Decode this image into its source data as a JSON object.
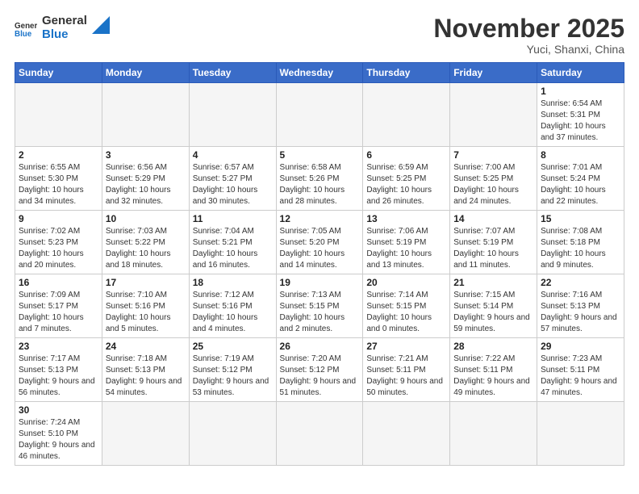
{
  "logo": {
    "text_general": "General",
    "text_blue": "Blue"
  },
  "header": {
    "month": "November 2025",
    "location": "Yuci, Shanxi, China"
  },
  "weekdays": [
    "Sunday",
    "Monday",
    "Tuesday",
    "Wednesday",
    "Thursday",
    "Friday",
    "Saturday"
  ],
  "weeks": [
    [
      {
        "day": "",
        "info": ""
      },
      {
        "day": "",
        "info": ""
      },
      {
        "day": "",
        "info": ""
      },
      {
        "day": "",
        "info": ""
      },
      {
        "day": "",
        "info": ""
      },
      {
        "day": "",
        "info": ""
      },
      {
        "day": "1",
        "info": "Sunrise: 6:54 AM\nSunset: 5:31 PM\nDaylight: 10 hours and 37 minutes."
      }
    ],
    [
      {
        "day": "2",
        "info": "Sunrise: 6:55 AM\nSunset: 5:30 PM\nDaylight: 10 hours and 34 minutes."
      },
      {
        "day": "3",
        "info": "Sunrise: 6:56 AM\nSunset: 5:29 PM\nDaylight: 10 hours and 32 minutes."
      },
      {
        "day": "4",
        "info": "Sunrise: 6:57 AM\nSunset: 5:27 PM\nDaylight: 10 hours and 30 minutes."
      },
      {
        "day": "5",
        "info": "Sunrise: 6:58 AM\nSunset: 5:26 PM\nDaylight: 10 hours and 28 minutes."
      },
      {
        "day": "6",
        "info": "Sunrise: 6:59 AM\nSunset: 5:25 PM\nDaylight: 10 hours and 26 minutes."
      },
      {
        "day": "7",
        "info": "Sunrise: 7:00 AM\nSunset: 5:25 PM\nDaylight: 10 hours and 24 minutes."
      },
      {
        "day": "8",
        "info": "Sunrise: 7:01 AM\nSunset: 5:24 PM\nDaylight: 10 hours and 22 minutes."
      }
    ],
    [
      {
        "day": "9",
        "info": "Sunrise: 7:02 AM\nSunset: 5:23 PM\nDaylight: 10 hours and 20 minutes."
      },
      {
        "day": "10",
        "info": "Sunrise: 7:03 AM\nSunset: 5:22 PM\nDaylight: 10 hours and 18 minutes."
      },
      {
        "day": "11",
        "info": "Sunrise: 7:04 AM\nSunset: 5:21 PM\nDaylight: 10 hours and 16 minutes."
      },
      {
        "day": "12",
        "info": "Sunrise: 7:05 AM\nSunset: 5:20 PM\nDaylight: 10 hours and 14 minutes."
      },
      {
        "day": "13",
        "info": "Sunrise: 7:06 AM\nSunset: 5:19 PM\nDaylight: 10 hours and 13 minutes."
      },
      {
        "day": "14",
        "info": "Sunrise: 7:07 AM\nSunset: 5:19 PM\nDaylight: 10 hours and 11 minutes."
      },
      {
        "day": "15",
        "info": "Sunrise: 7:08 AM\nSunset: 5:18 PM\nDaylight: 10 hours and 9 minutes."
      }
    ],
    [
      {
        "day": "16",
        "info": "Sunrise: 7:09 AM\nSunset: 5:17 PM\nDaylight: 10 hours and 7 minutes."
      },
      {
        "day": "17",
        "info": "Sunrise: 7:10 AM\nSunset: 5:16 PM\nDaylight: 10 hours and 5 minutes."
      },
      {
        "day": "18",
        "info": "Sunrise: 7:12 AM\nSunset: 5:16 PM\nDaylight: 10 hours and 4 minutes."
      },
      {
        "day": "19",
        "info": "Sunrise: 7:13 AM\nSunset: 5:15 PM\nDaylight: 10 hours and 2 minutes."
      },
      {
        "day": "20",
        "info": "Sunrise: 7:14 AM\nSunset: 5:15 PM\nDaylight: 10 hours and 0 minutes."
      },
      {
        "day": "21",
        "info": "Sunrise: 7:15 AM\nSunset: 5:14 PM\nDaylight: 9 hours and 59 minutes."
      },
      {
        "day": "22",
        "info": "Sunrise: 7:16 AM\nSunset: 5:13 PM\nDaylight: 9 hours and 57 minutes."
      }
    ],
    [
      {
        "day": "23",
        "info": "Sunrise: 7:17 AM\nSunset: 5:13 PM\nDaylight: 9 hours and 56 minutes."
      },
      {
        "day": "24",
        "info": "Sunrise: 7:18 AM\nSunset: 5:13 PM\nDaylight: 9 hours and 54 minutes."
      },
      {
        "day": "25",
        "info": "Sunrise: 7:19 AM\nSunset: 5:12 PM\nDaylight: 9 hours and 53 minutes."
      },
      {
        "day": "26",
        "info": "Sunrise: 7:20 AM\nSunset: 5:12 PM\nDaylight: 9 hours and 51 minutes."
      },
      {
        "day": "27",
        "info": "Sunrise: 7:21 AM\nSunset: 5:11 PM\nDaylight: 9 hours and 50 minutes."
      },
      {
        "day": "28",
        "info": "Sunrise: 7:22 AM\nSunset: 5:11 PM\nDaylight: 9 hours and 49 minutes."
      },
      {
        "day": "29",
        "info": "Sunrise: 7:23 AM\nSunset: 5:11 PM\nDaylight: 9 hours and 47 minutes."
      }
    ],
    [
      {
        "day": "30",
        "info": "Sunrise: 7:24 AM\nSunset: 5:10 PM\nDaylight: 9 hours and 46 minutes."
      },
      {
        "day": "",
        "info": ""
      },
      {
        "day": "",
        "info": ""
      },
      {
        "day": "",
        "info": ""
      },
      {
        "day": "",
        "info": ""
      },
      {
        "day": "",
        "info": ""
      },
      {
        "day": "",
        "info": ""
      }
    ]
  ]
}
